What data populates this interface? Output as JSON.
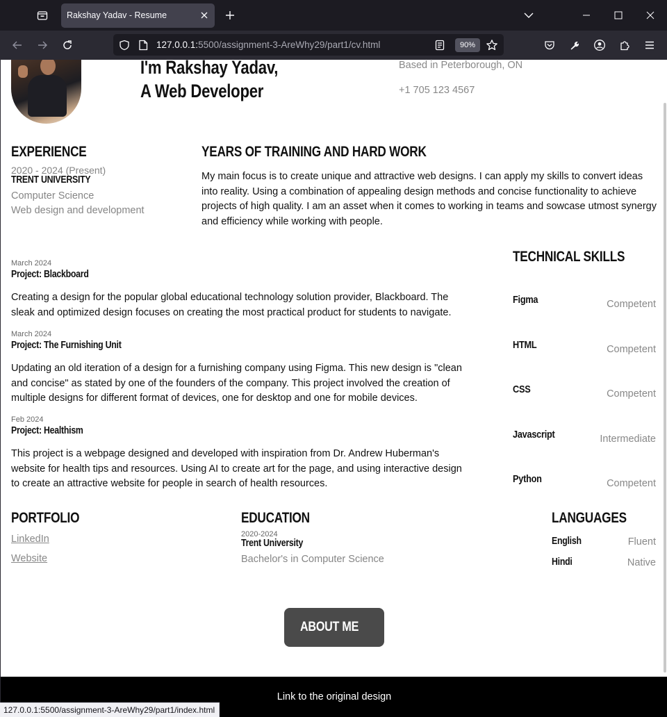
{
  "browser": {
    "tab_title": "Rakshay Yadav - Resume",
    "url_host": "127.0.0.1:",
    "url_path": "5500/assignment-3-AreWhy29/part1/cv.html",
    "zoom": "90%",
    "status_url": "127.0.0.1:5500/assignment-3-AreWhy29/part1/index.html"
  },
  "hero": {
    "line1": "I'm Rakshay Yadav,",
    "line2": "A Web Developer",
    "location": "Based in Peterborough, ON",
    "phone": "+1 705 123 4567"
  },
  "experience": {
    "heading": "EXPERIENCE",
    "dates": "2020 - 2024 (Present)",
    "org": "TRENT UNIVERSITY",
    "field": "Computer Science",
    "focus": "Web design and development"
  },
  "training": {
    "heading": "YEARS OF TRAINING AND HARD WORK",
    "body": "My main focus is to create unique and attractive web designs. I can apply my skills to convert ideas into reality. Using a combination of appealing design methods and concise functionality to achieve projects of high quality. I am an asset when it comes to working in teams and sowcase utmost synergy and efficiency while working with people."
  },
  "projects": [
    {
      "date": "March 2024",
      "title": "Project: Blackboard",
      "body": "Creating a design for the popular global educational technology solution provider, Blackboard. The sleak and optimized design focuses on creating the most practical product for students to navigate."
    },
    {
      "date": "March 2024",
      "title": "Project: The Furnishing Unit",
      "body": "Updating an old iteration of a design for a furnishing company using Figma. This new design is \"clean and concise\" as stated by one of the founders of the company. This project involved the creation of multiple designs for different format of devices, one for desktop and one for mobile devices."
    },
    {
      "date": "Feb 2024",
      "title": "Project: Healthism",
      "body": "This project is a webpage designed and developed with inspiration from Dr. Andrew Huberman's website for health tips and resources. Using AI to create art for the page, and using interactive design to create an attractive website for people in search of health resources."
    }
  ],
  "skills": {
    "heading": "TECHNICAL SKILLS",
    "items": [
      {
        "name": "Figma",
        "level": "Competent"
      },
      {
        "name": "HTML",
        "level": "Competent"
      },
      {
        "name": "CSS",
        "level": "Competent"
      },
      {
        "name": "Javascript",
        "level": "Intermediate"
      },
      {
        "name": "Python",
        "level": "Competent"
      }
    ]
  },
  "portfolio": {
    "heading": "PORTFOLIO",
    "links": [
      "LinkedIn",
      "Website"
    ]
  },
  "education": {
    "heading": "EDUCATION",
    "dates": "2020-2024",
    "school": "Trent University",
    "degree": "Bachelor's in Computer Science"
  },
  "languages": {
    "heading": "LANGUAGES",
    "items": [
      {
        "name": "English",
        "level": "Fluent"
      },
      {
        "name": "Hindi",
        "level": "Native"
      }
    ]
  },
  "about_button": "ABOUT ME",
  "footer_link": "Link to the original design"
}
